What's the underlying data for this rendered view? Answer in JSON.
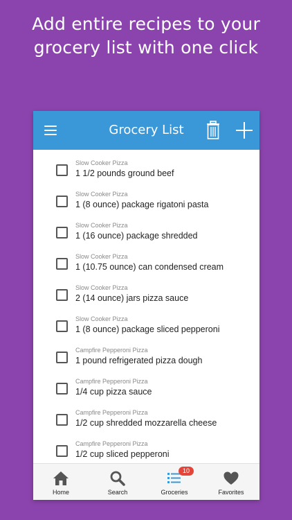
{
  "promo": {
    "line1": "Add entire recipes to your",
    "line2": "grocery list with one click"
  },
  "appbar": {
    "title": "Grocery List",
    "menu_icon": "hamburger-icon",
    "trash_icon": "trash-icon",
    "add_icon": "plus-icon"
  },
  "items": [
    {
      "source": "Slow Cooker Pizza",
      "text": "1 1/2 pounds ground beef"
    },
    {
      "source": "Slow Cooker Pizza",
      "text": "1 (8 ounce) package rigatoni pasta"
    },
    {
      "source": "Slow Cooker Pizza",
      "text": "1 (16 ounce) package shredded"
    },
    {
      "source": "Slow Cooker Pizza",
      "text": "1 (10.75 ounce) can condensed cream"
    },
    {
      "source": "Slow Cooker Pizza",
      "text": "2 (14 ounce) jars pizza sauce"
    },
    {
      "source": "Slow Cooker Pizza",
      "text": "1 (8 ounce) package sliced pepperoni"
    },
    {
      "source": "Campfire Pepperoni Pizza",
      "text": "1 pound refrigerated pizza dough"
    },
    {
      "source": "Campfire Pepperoni Pizza",
      "text": "1/4 cup pizza sauce"
    },
    {
      "source": "Campfire Pepperoni Pizza",
      "text": "1/2 cup shredded mozzarella cheese"
    },
    {
      "source": "Campfire Pepperoni Pizza",
      "text": "1/2 cup sliced pepperoni"
    }
  ],
  "nav": {
    "home": "Home",
    "search": "Search",
    "groceries": "Groceries",
    "groceries_badge": "10",
    "favorites": "Favorites"
  },
  "colors": {
    "background": "#8b44ad",
    "appbar": "#3a98d9",
    "badge": "#e2463b",
    "active_nav": "#3a98d9"
  }
}
